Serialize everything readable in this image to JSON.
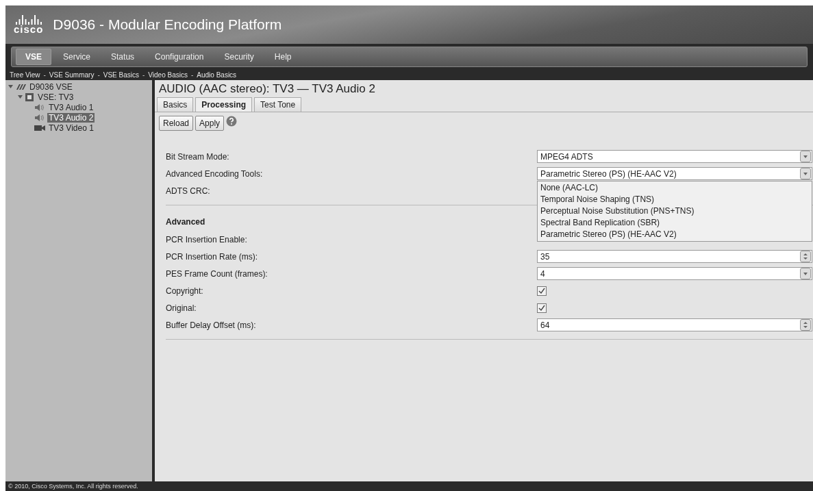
{
  "header": {
    "logo": "cisco",
    "title": "D9036 - Modular Encoding Platform"
  },
  "menu": [
    {
      "label": "VSE",
      "selected": true
    },
    {
      "label": "Service",
      "selected": false
    },
    {
      "label": "Status",
      "selected": false
    },
    {
      "label": "Configuration",
      "selected": false
    },
    {
      "label": "Security",
      "selected": false
    },
    {
      "label": "Help",
      "selected": false
    }
  ],
  "breadcrumb": {
    "separator": "-",
    "items": [
      "Tree View",
      "VSE Summary",
      "VSE Basics",
      "Video Basics",
      "Audio Basics"
    ]
  },
  "tree": [
    {
      "label": "D9036 VSE",
      "kind": "platform",
      "expanded": true,
      "selected": false,
      "children": [
        {
          "label": "VSE: TV3",
          "kind": "vse",
          "expanded": true,
          "selected": false,
          "children": [
            {
              "label": "TV3 Audio 1",
              "kind": "audio",
              "selected": false
            },
            {
              "label": "TV3 Audio 2",
              "kind": "audio",
              "selected": true
            },
            {
              "label": "TV3 Video 1",
              "kind": "video",
              "selected": false
            }
          ]
        }
      ]
    }
  ],
  "page": {
    "title": "AUDIO (AAC stereo): TV3 — TV3 Audio 2",
    "tabs": [
      {
        "label": "Basics",
        "selected": false
      },
      {
        "label": "Processing",
        "selected": true
      },
      {
        "label": "Test Tone",
        "selected": false
      }
    ],
    "buttons": [
      "Reload",
      "Apply"
    ],
    "sections": [
      {
        "rows": [
          {
            "label": "Bit Stream Mode:",
            "kind": "select",
            "value": "MPEG4 ADTS"
          },
          {
            "label": "Advanced Encoding Tools:",
            "kind": "select",
            "value": "Parametric Stereo (PS) (HE-AAC V2)",
            "options": [
              "None (AAC-LC)",
              "Temporal Noise Shaping (TNS)",
              "Perceptual Noise Substitution (PNS+TNS)",
              "Spectral Band Replication (SBR)",
              "Parametric Stereo (PS) (HE-AAC V2)"
            ]
          },
          {
            "label": "ADTS CRC:",
            "kind": "covered"
          }
        ]
      },
      {
        "heading": "Advanced",
        "rows": [
          {
            "label": "PCR Insertion Enable:",
            "kind": "covered"
          },
          {
            "label": "PCR Insertion Rate (ms):",
            "kind": "spin",
            "value": "35"
          },
          {
            "label": "PES Frame Count (frames):",
            "kind": "select",
            "value": "4"
          },
          {
            "label": "Copyright:",
            "kind": "checkbox",
            "checked": true
          },
          {
            "label": "Original:",
            "kind": "checkbox",
            "checked": true
          },
          {
            "label": "Buffer Delay Offset (ms):",
            "kind": "spin",
            "value": "64"
          }
        ]
      }
    ]
  },
  "footer": "© 2010, Cisco Systems, Inc. All rights reserved."
}
